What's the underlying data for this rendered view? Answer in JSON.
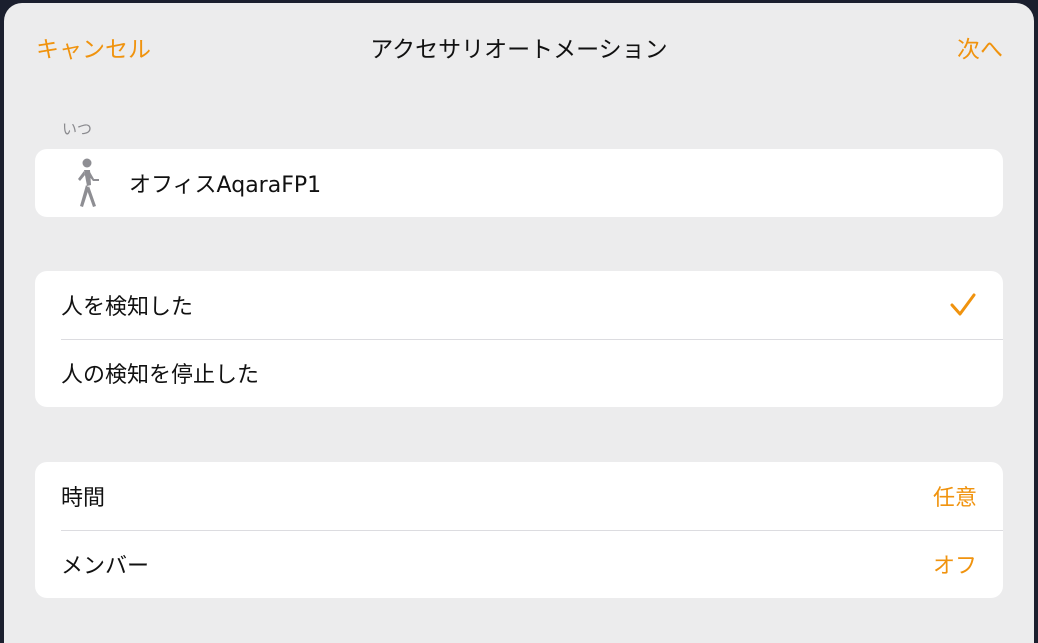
{
  "navbar": {
    "cancel_label": "キャンセル",
    "title": "アクセサリオートメーション",
    "next_label": "次へ"
  },
  "when_section": {
    "header": "いつ",
    "accessory": {
      "icon": "person-walking-icon",
      "name": "オフィスAqaraFP1"
    }
  },
  "trigger_options": [
    {
      "label": "人を検知した",
      "selected": true
    },
    {
      "label": "人の検知を停止した",
      "selected": false
    }
  ],
  "conditions": [
    {
      "label": "時間",
      "value": "任意"
    },
    {
      "label": "メンバー",
      "value": "オフ"
    }
  ],
  "colors": {
    "accent": "#f0930e",
    "background": "#ececed",
    "card": "#ffffff"
  }
}
